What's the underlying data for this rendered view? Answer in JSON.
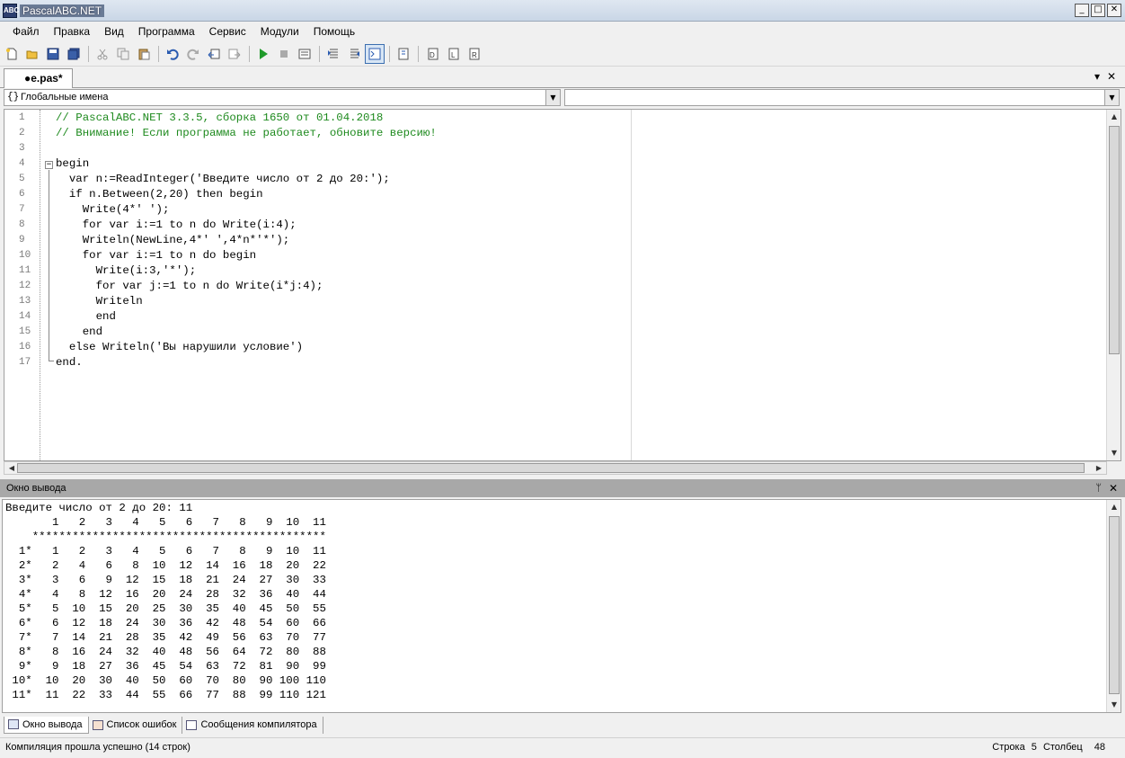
{
  "window": {
    "title": "PascalABC.NET",
    "app_icon_text": "ABC"
  },
  "menu": [
    "Файл",
    "Правка",
    "Вид",
    "Программа",
    "Сервис",
    "Модули",
    "Помощь"
  ],
  "tab": {
    "label": "●e.pas*"
  },
  "combo_left": {
    "value": "Глобальные имена",
    "icon": "{}"
  },
  "combo_right": {
    "value": ""
  },
  "code_lines": [
    "// PascalABC.NET 3.3.5, сборка 1650 от 01.04.2018",
    "// Внимание! Если программа не работает, обновите версию!",
    "",
    "begin",
    "  var n:=ReadInteger('Введите число от 2 до 20:');",
    "  if n.Between(2,20) then begin",
    "    Write(4*' ');",
    "    for var i:=1 to n do Write(i:4);",
    "    Writeln(NewLine,4*' ',4*n*'*');",
    "    for var i:=1 to n do begin",
    "      Write(i:3,'*');",
    "      for var j:=1 to n do Write(i*j:4);",
    "      Writeln",
    "      end",
    "    end",
    "  else Writeln('Вы нарушили условие')",
    "end."
  ],
  "line_numbers": [
    "1",
    "2",
    "3",
    "4",
    "5",
    "6",
    "7",
    "8",
    "9",
    "10",
    "11",
    "12",
    "13",
    "14",
    "15",
    "16",
    "17"
  ],
  "output_panel": {
    "title": "Окно вывода",
    "lines": [
      "Введите число от 2 до 20: 11",
      "       1   2   3   4   5   6   7   8   9  10  11",
      "    ********************************************",
      "  1*   1   2   3   4   5   6   7   8   9  10  11",
      "  2*   2   4   6   8  10  12  14  16  18  20  22",
      "  3*   3   6   9  12  15  18  21  24  27  30  33",
      "  4*   4   8  12  16  20  24  28  32  36  40  44",
      "  5*   5  10  15  20  25  30  35  40  45  50  55",
      "  6*   6  12  18  24  30  36  42  48  54  60  66",
      "  7*   7  14  21  28  35  42  49  56  63  70  77",
      "  8*   8  16  24  32  40  48  56  64  72  80  88",
      "  9*   9  18  27  36  45  54  63  72  81  90  99",
      " 10*  10  20  30  40  50  60  70  80  90 100 110",
      " 11*  11  22  33  44  55  66  77  88  99 110 121"
    ]
  },
  "bottom_tabs": [
    "Окно вывода",
    "Список ошибок",
    "Сообщения компилятора"
  ],
  "status": {
    "message": "Компиляция прошла успешно (14 строк)",
    "row_label": "Строка",
    "row_value": "5",
    "col_label": "Столбец",
    "col_value": "48"
  },
  "colors": {
    "comment": "#1e8a1e",
    "string": "#1a2aa8",
    "number": "#0a7a0a",
    "output_header": "#a8a8a8"
  }
}
